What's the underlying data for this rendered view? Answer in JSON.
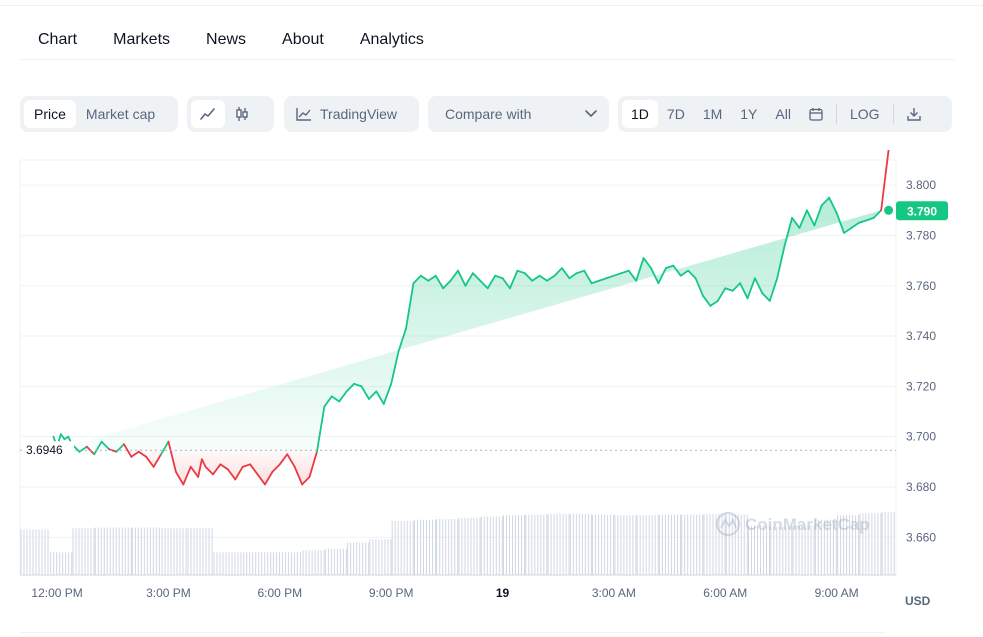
{
  "tabs": [
    {
      "label": "Chart",
      "active": true
    },
    {
      "label": "Markets",
      "active": false
    },
    {
      "label": "News",
      "active": false
    },
    {
      "label": "About",
      "active": false
    },
    {
      "label": "Analytics",
      "active": false
    }
  ],
  "toolbar": {
    "price_label": "Price",
    "marketcap_label": "Market cap",
    "line_icon": "line-chart-icon",
    "candle_icon": "candlestick-icon",
    "tradingview_label": "TradingView",
    "tradingview_icon": "trading-view-icon",
    "compare_label": "Compare with",
    "compare_icon": "chevron-down-icon",
    "ranges": [
      "1D",
      "7D",
      "1M",
      "1Y",
      "All"
    ],
    "active_range": "1D",
    "calendar_icon": "calendar-icon",
    "log_label": "LOG",
    "download_icon": "download-icon"
  },
  "colors": {
    "accent": "#3861fb",
    "up": "#16c784",
    "down": "#ea3943",
    "grid": "#eff2f5",
    "axis_text": "#58667e"
  },
  "chart_data": {
    "type": "area",
    "currency_label": "USD",
    "watermark": "CoinMarketCap",
    "reference_price": 3.6946,
    "reference_price_label": "3.6946",
    "current_price": 3.79,
    "current_price_label": "3.790",
    "ylim": [
      3.645,
      3.81
    ],
    "ytick_values": [
      3.8,
      3.78,
      3.76,
      3.74,
      3.72,
      3.7,
      3.68,
      3.66
    ],
    "ytick_labels": [
      "3.800",
      "3.780",
      "3.760",
      "3.740",
      "3.720",
      "3.700",
      "3.680",
      "3.660"
    ],
    "xlim_hours": [
      11,
      34.6
    ],
    "xtick_hours": [
      12,
      15,
      18,
      21,
      24,
      27,
      30,
      33
    ],
    "xtick_labels": [
      "12:00 PM",
      "3:00 PM",
      "6:00 PM",
      "9:00 PM",
      "19",
      "3:00 AM",
      "6:00 AM",
      "9:00 AM"
    ],
    "xtick_bold": [
      false,
      false,
      false,
      false,
      true,
      false,
      false,
      false
    ],
    "price_series": {
      "x": [
        11.9,
        12.0,
        12.1,
        12.2,
        12.3,
        12.4,
        12.6,
        12.8,
        13.0,
        13.2,
        13.4,
        13.6,
        13.8,
        14.0,
        14.2,
        14.4,
        14.6,
        14.8,
        15.0,
        15.2,
        15.4,
        15.6,
        15.8,
        15.9,
        16.0,
        16.2,
        16.4,
        16.6,
        16.8,
        17.0,
        17.2,
        17.4,
        17.6,
        17.8,
        18.0,
        18.2,
        18.4,
        18.6,
        18.8,
        19.0,
        19.2,
        19.4,
        19.6,
        19.8,
        20.0,
        20.2,
        20.4,
        20.6,
        20.8,
        21.0,
        21.2,
        21.4,
        21.6,
        21.8,
        22.0,
        22.2,
        22.4,
        22.6,
        22.8,
        23.0,
        23.2,
        23.4,
        23.6,
        23.8,
        24.0,
        24.2,
        24.4,
        24.6,
        24.8,
        25.0,
        25.2,
        25.4,
        25.6,
        25.8,
        26.0,
        26.2,
        26.4,
        26.6,
        26.8,
        27.0,
        27.2,
        27.4,
        27.6,
        27.8,
        28.0,
        28.2,
        28.4,
        28.6,
        28.8,
        29.0,
        29.2,
        29.4,
        29.6,
        29.8,
        30.0,
        30.2,
        30.4,
        30.6,
        30.8,
        31.0,
        31.2,
        31.4,
        31.6,
        31.8,
        32.0,
        32.2,
        32.4,
        32.6,
        32.8,
        33.0,
        33.2,
        33.4,
        33.6,
        33.8,
        34.0,
        34.2,
        34.4
      ],
      "y": [
        3.7,
        3.696,
        3.701,
        3.699,
        3.7,
        3.697,
        3.694,
        3.696,
        3.693,
        3.698,
        3.695,
        3.694,
        3.697,
        3.692,
        3.694,
        3.692,
        3.688,
        3.693,
        3.698,
        3.686,
        3.681,
        3.688,
        3.684,
        3.691,
        3.688,
        3.685,
        3.689,
        3.687,
        3.683,
        3.688,
        3.689,
        3.685,
        3.681,
        3.686,
        3.689,
        3.693,
        3.688,
        3.681,
        3.684,
        3.694,
        3.712,
        3.716,
        3.714,
        3.718,
        3.721,
        3.72,
        3.715,
        3.718,
        3.713,
        3.721,
        3.734,
        3.743,
        3.761,
        3.764,
        3.762,
        3.764,
        3.759,
        3.762,
        3.766,
        3.76,
        3.765,
        3.762,
        3.759,
        3.764,
        3.763,
        3.759,
        3.766,
        3.765,
        3.762,
        3.764,
        3.762,
        3.764,
        3.767,
        3.763,
        3.765,
        3.766,
        3.761,
        3.762,
        3.763,
        3.764,
        3.765,
        3.766,
        3.762,
        3.771,
        3.767,
        3.761,
        3.767,
        3.768,
        3.764,
        3.766,
        3.763,
        3.756,
        3.752,
        3.754,
        3.759,
        3.758,
        3.761,
        3.755,
        3.763,
        3.757,
        3.754,
        3.763,
        3.776,
        3.787,
        3.783,
        3.79,
        3.784,
        3.792,
        3.795,
        3.789,
        3.781,
        3.783,
        3.785,
        3.786,
        3.787,
        3.79
      ]
    },
    "volume_series": {
      "x": [
        11.0,
        11.8,
        12.4,
        13.0,
        14.0,
        14.8,
        15.5,
        16.2,
        17.0,
        17.8,
        18.6,
        19.2,
        19.8,
        20.4,
        21.0,
        21.6,
        22.2,
        22.8,
        23.4,
        24.0,
        24.6,
        25.2,
        25.8,
        26.4,
        27.0,
        27.6,
        28.2,
        28.8,
        29.4,
        30.0,
        30.6,
        31.2,
        31.8,
        32.4,
        33.0,
        33.6,
        34.2,
        34.6
      ],
      "y": [
        0.7,
        0.35,
        0.72,
        0.73,
        0.73,
        0.72,
        0.72,
        0.35,
        0.35,
        0.35,
        0.38,
        0.4,
        0.5,
        0.55,
        0.83,
        0.85,
        0.86,
        0.88,
        0.9,
        0.92,
        0.93,
        0.94,
        0.94,
        0.93,
        0.92,
        0.92,
        0.93,
        0.93,
        0.94,
        0.93,
        0.76,
        0.74,
        0.76,
        0.85,
        0.92,
        0.95,
        0.97,
        0.96
      ]
    }
  }
}
